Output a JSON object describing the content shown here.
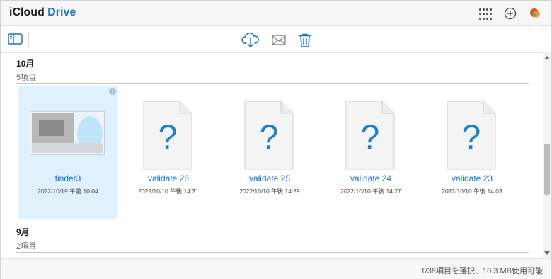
{
  "header": {
    "title_part1": "iCloud",
    "title_part2": "Drive",
    "apps_icon": "app-grid-icon",
    "add_icon": "plus-circle-icon",
    "avatar_icon": "avatar-icon"
  },
  "toolbar": {
    "sidebar_icon": "sidebar-icon",
    "download_icon": "cloud-download-icon",
    "mail_icon": "envelope-icon",
    "delete_icon": "trash-icon"
  },
  "sections": [
    {
      "month": "10月",
      "count": "5項目",
      "files": [
        {
          "name": "finder3",
          "date": "2022/10/19 午前 10:04",
          "selected": true,
          "thumbnail": "image"
        },
        {
          "name": "validate 26",
          "date": "2022/10/10 午後 14:31",
          "selected": false,
          "thumbnail": "unknown"
        },
        {
          "name": "validate 25",
          "date": "2022/10/10 午後 14:29",
          "selected": false,
          "thumbnail": "unknown"
        },
        {
          "name": "validate 24",
          "date": "2022/10/10 午後 14:27",
          "selected": false,
          "thumbnail": "unknown"
        },
        {
          "name": "validate 23",
          "date": "2022/10/10 午後 14:03",
          "selected": false,
          "thumbnail": "unknown"
        }
      ]
    },
    {
      "month": "9月",
      "count": "2項目",
      "files": []
    }
  ],
  "status": {
    "text": "1/38項目を選択、10.3 MB使用可能"
  },
  "colors": {
    "accent": "#1a73c8",
    "selection": "#dff1fd",
    "question_mark": "#1e7fd0"
  }
}
